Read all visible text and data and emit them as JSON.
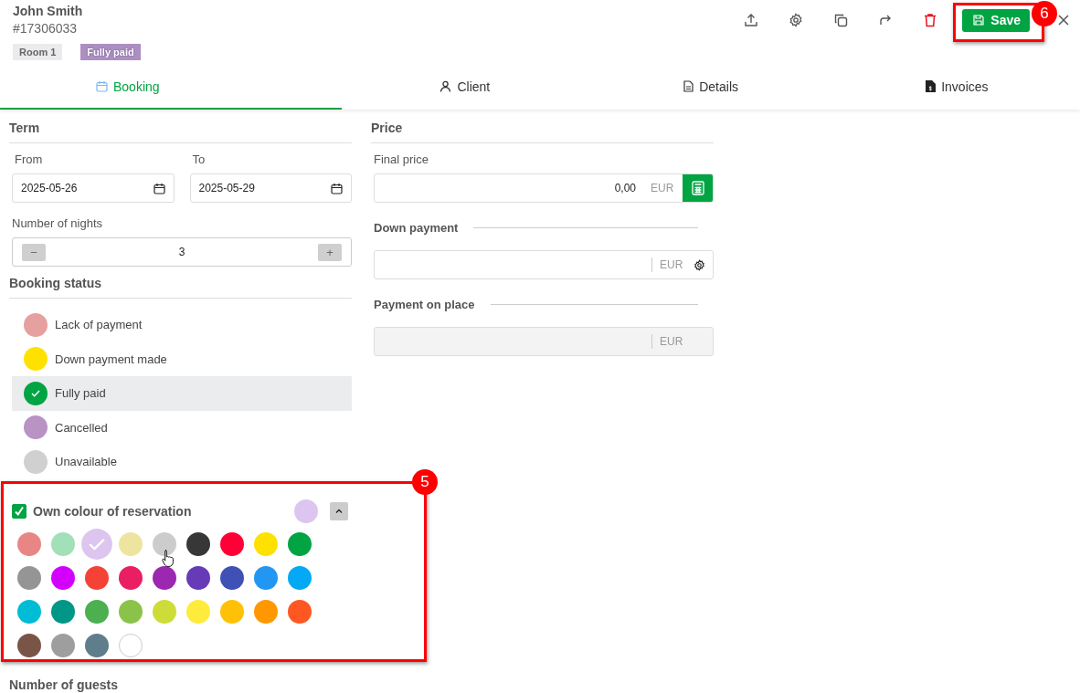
{
  "header": {
    "name": "John Smith",
    "booking_id": "#17306033",
    "tags": [
      {
        "label": "Room 1",
        "kind": "room"
      },
      {
        "label": "Fully paid",
        "kind": "status"
      }
    ]
  },
  "save_button": "Save",
  "tabs": [
    {
      "label": "Booking",
      "selected": true
    },
    {
      "label": "Client",
      "selected": false
    },
    {
      "label": "Details",
      "selected": false
    },
    {
      "label": "Invoices",
      "selected": false
    }
  ],
  "term": {
    "title": "Term",
    "from": {
      "label": "From",
      "value": "2025-05-26"
    },
    "to": {
      "label": "To",
      "value": "2025-05-29"
    },
    "nights": {
      "label": "Number of nights",
      "value": "3",
      "minus": "−",
      "plus": "+"
    }
  },
  "booking_status": {
    "title": "Booking status",
    "items": [
      {
        "label": "Lack of payment",
        "color": "#e5a09f",
        "selected": false
      },
      {
        "label": "Down payment made",
        "color": "#ffe100",
        "selected": false
      },
      {
        "label": "Fully paid",
        "color": "#00a443",
        "selected": true
      },
      {
        "label": "Cancelled",
        "color": "#b893c4",
        "selected": false
      },
      {
        "label": "Unavailable",
        "color": "#d0d0d0",
        "selected": false
      }
    ]
  },
  "own_colour": {
    "label": "Own colour of reservation",
    "checked": true,
    "expanded": true,
    "swatches": [
      {
        "color": "#e88686",
        "selected": false
      },
      {
        "color": "#a1e0b8",
        "selected": false
      },
      {
        "color": "#dcc5ef",
        "selected": true
      },
      {
        "color": "#ede59f",
        "selected": false
      },
      {
        "color": "#cccccc",
        "selected": false
      },
      {
        "color": "#373737",
        "selected": false
      },
      {
        "color": "#ff0036",
        "selected": false
      },
      {
        "color": "#ffe100",
        "selected": false
      },
      {
        "color": "#00a443",
        "selected": false
      },
      {
        "color": "#959595",
        "selected": false
      },
      {
        "color": "#d400ff",
        "selected": false
      },
      {
        "color": "#f44336",
        "selected": false
      },
      {
        "color": "#e91e63",
        "selected": false
      },
      {
        "color": "#9c27b0",
        "selected": false
      },
      {
        "color": "#673ab7",
        "selected": false
      },
      {
        "color": "#3f51b5",
        "selected": false
      },
      {
        "color": "#2196f3",
        "selected": false
      },
      {
        "color": "#03a9f4",
        "selected": false
      },
      {
        "color": "#00bcd4",
        "selected": false
      },
      {
        "color": "#009688",
        "selected": false
      },
      {
        "color": "#4caf50",
        "selected": false
      },
      {
        "color": "#8bc34a",
        "selected": false
      },
      {
        "color": "#cddc39",
        "selected": false
      },
      {
        "color": "#ffeb3b",
        "selected": false
      },
      {
        "color": "#ffc107",
        "selected": false
      },
      {
        "color": "#ff9800",
        "selected": false
      },
      {
        "color": "#ff5722",
        "selected": false
      },
      {
        "color": "#795548",
        "selected": false
      },
      {
        "color": "#9e9e9e",
        "selected": false
      },
      {
        "color": "#607d8b",
        "selected": false
      },
      {
        "color": "#ffffff",
        "selected": false
      }
    ]
  },
  "number_of_guests": {
    "title": "Number of guests"
  },
  "price": {
    "title": "Price",
    "final_price": {
      "label": "Final price",
      "value": "0,00",
      "currency": "EUR"
    },
    "down_payment": {
      "label": "Down payment",
      "currency": "EUR"
    },
    "payment_on_place": {
      "label": "Payment on place",
      "currency": "EUR",
      "disabled": true
    }
  },
  "annotations": [
    {
      "number": "5"
    },
    {
      "number": "6"
    }
  ]
}
